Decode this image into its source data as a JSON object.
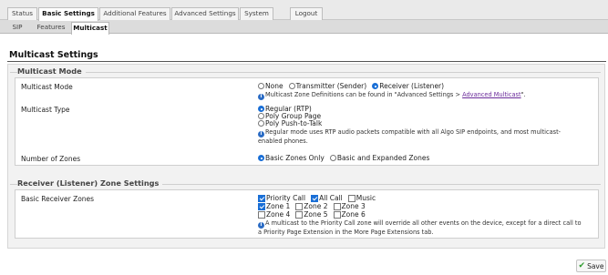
{
  "nav": {
    "tabs": [
      {
        "label": "Status"
      },
      {
        "label": "Basic Settings"
      },
      {
        "label": "Additional Features"
      },
      {
        "label": "Advanced Settings"
      },
      {
        "label": "System"
      }
    ],
    "logout": "Logout",
    "subtabs": [
      {
        "label": "SIP"
      },
      {
        "label": "Features"
      },
      {
        "label": "Multicast"
      }
    ]
  },
  "page": {
    "title": "Multicast Settings"
  },
  "multicast_mode_section": {
    "legend": "Multicast Mode",
    "mode": {
      "label": "Multicast Mode",
      "options": [
        "None",
        "Transmitter (Sender)",
        "Receiver (Listener)"
      ],
      "selected": "Receiver (Listener)",
      "note_prefix": "Multicast Zone Definitions can be found in \"Advanced Settings > ",
      "note_link": "Advanced Multicast",
      "note_suffix": "\"."
    },
    "type": {
      "label": "Multicast Type",
      "options": [
        "Regular (RTP)",
        "Poly Group Page",
        "Poly Push-to-Talk"
      ],
      "selected": "Regular (RTP)",
      "note_line1": "Regular mode uses RTP audio packets compatible with all Algo SIP endpoints, and most multicast-",
      "note_line2": "enabled phones."
    },
    "zones": {
      "label": "Number of Zones",
      "options": [
        "Basic Zones Only",
        "Basic and Expanded Zones"
      ],
      "selected": "Basic Zones Only"
    }
  },
  "receiver_section": {
    "legend": "Receiver (Listener) Zone Settings",
    "basic_zones": {
      "label": "Basic Receiver Zones",
      "checkboxes": [
        {
          "label": "Priority Call",
          "checked": true
        },
        {
          "label": "All Call",
          "checked": true
        },
        {
          "label": "Music",
          "checked": false
        },
        {
          "label": "Zone 1",
          "checked": true
        },
        {
          "label": "Zone 2",
          "checked": false
        },
        {
          "label": "Zone 3",
          "checked": false
        },
        {
          "label": "Zone 4",
          "checked": false
        },
        {
          "label": "Zone 5",
          "checked": false
        },
        {
          "label": "Zone 6",
          "checked": false
        }
      ],
      "note_line1": "A multicast to the Priority Call zone will override all other events on the device, except for a direct call to",
      "note_line2": "a Priority Page Extension in the More Page Extensions tab."
    }
  },
  "footer": {
    "save_label": "Save"
  },
  "colors": {
    "accent": "#1a6fd6",
    "link": "#6a2a9a",
    "save_check": "#2e9b2e"
  },
  "icons": {
    "info": "info-icon",
    "save": "checkmark-icon"
  }
}
